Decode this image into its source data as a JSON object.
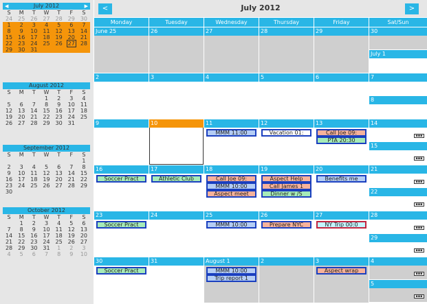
{
  "sidebar": {
    "months": [
      {
        "name": "July 2012",
        "prev": "◀",
        "next": "▶",
        "dow": [
          "S",
          "M",
          "T",
          "W",
          "T",
          "F",
          "S"
        ],
        "weeks": [
          [
            "24",
            "25",
            "26",
            "27",
            "28",
            "29",
            "30"
          ],
          [
            "1",
            "2",
            "3",
            "4",
            "5",
            "6",
            "7"
          ],
          [
            "8",
            "9",
            "10",
            "11",
            "12",
            "13",
            "14"
          ],
          [
            "15",
            "16",
            "17",
            "18",
            "19",
            "20",
            "21"
          ],
          [
            "22",
            "23",
            "24",
            "25",
            "26",
            "27",
            "28"
          ],
          [
            "29",
            "30",
            "31",
            "",
            "",
            "",
            ""
          ]
        ]
      },
      {
        "name": "August 2012",
        "dow": [
          "S",
          "M",
          "T",
          "W",
          "T",
          "F",
          "S"
        ],
        "weeks": [
          [
            "",
            "",
            "",
            "1",
            "2",
            "3",
            "4"
          ],
          [
            "5",
            "6",
            "7",
            "8",
            "9",
            "10",
            "11"
          ],
          [
            "12",
            "13",
            "14",
            "15",
            "16",
            "17",
            "18"
          ],
          [
            "19",
            "20",
            "21",
            "22",
            "23",
            "24",
            "25"
          ],
          [
            "26",
            "27",
            "28",
            "29",
            "30",
            "31",
            ""
          ]
        ]
      },
      {
        "name": "September 2012",
        "dow": [
          "S",
          "M",
          "T",
          "W",
          "T",
          "F",
          "S"
        ],
        "weeks": [
          [
            "",
            "",
            "",
            "",
            "",
            "",
            "1"
          ],
          [
            "2",
            "3",
            "4",
            "5",
            "6",
            "7",
            "8"
          ],
          [
            "9",
            "10",
            "11",
            "12",
            "13",
            "14",
            "15"
          ],
          [
            "16",
            "17",
            "18",
            "19",
            "20",
            "21",
            "22"
          ],
          [
            "23",
            "24",
            "25",
            "26",
            "27",
            "28",
            "29"
          ],
          [
            "30",
            "",
            "",
            "",
            "",
            "",
            ""
          ]
        ]
      },
      {
        "name": "October 2012",
        "dow": [
          "S",
          "M",
          "T",
          "W",
          "T",
          "F",
          "S"
        ],
        "weeks": [
          [
            "",
            "1",
            "2",
            "3",
            "4",
            "5",
            "6"
          ],
          [
            "7",
            "8",
            "9",
            "10",
            "11",
            "12",
            "13"
          ],
          [
            "14",
            "15",
            "16",
            "17",
            "18",
            "19",
            "20"
          ],
          [
            "21",
            "22",
            "23",
            "24",
            "25",
            "26",
            "27"
          ],
          [
            "28",
            "29",
            "30",
            "31",
            "1",
            "2",
            "3"
          ],
          [
            "4",
            "5",
            "6",
            "7",
            "8",
            "9",
            "10"
          ]
        ]
      }
    ]
  },
  "header": {
    "title": "July 2012",
    "prev": "<",
    "next": ">"
  },
  "days": [
    "Monday",
    "Tuesday",
    "Wednesday",
    "Thursday",
    "Friday",
    "Sat/Sun"
  ],
  "weeks": [
    {
      "days": [
        {
          "n": "June 25",
          "g": 1
        },
        {
          "n": "26",
          "g": 1
        },
        {
          "n": "27",
          "g": 1
        },
        {
          "n": "28",
          "g": 1
        },
        {
          "n": "29",
          "g": 1
        }
      ],
      "sat": "30",
      "sun": "July 1"
    },
    {
      "days": [
        {
          "n": "2"
        },
        {
          "n": "3"
        },
        {
          "n": "4"
        },
        {
          "n": "5"
        },
        {
          "n": "6"
        }
      ],
      "sat": "7",
      "sun": "8"
    },
    {
      "days": [
        {
          "n": "9"
        },
        {
          "n": "10",
          "t": 1
        },
        {
          "n": "11",
          "ev": [
            {
              "l": "MMM 11:00",
              "c": "blue"
            }
          ]
        },
        {
          "n": "12",
          "ev": [
            {
              "l": "Vacation 01:",
              "c": "white"
            }
          ]
        },
        {
          "n": "13",
          "ev": [
            {
              "l": "Call Joe 09:",
              "c": "pink"
            },
            {
              "l": "PTA 20:30",
              "c": "green"
            }
          ]
        }
      ],
      "sat": "14",
      "sun": "15",
      "mS": 1,
      "mU": 1
    },
    {
      "days": [
        {
          "n": "16",
          "ev": [
            {
              "l": "Soccer Pract",
              "c": "green"
            }
          ]
        },
        {
          "n": "17",
          "ev": [
            {
              "l": "Athletic Club",
              "c": "green"
            }
          ]
        },
        {
          "n": "18",
          "ev": [
            {
              "l": "Call Joe 09:",
              "c": "pink"
            },
            {
              "l": "MMM 10:00",
              "c": "blue"
            },
            {
              "l": "Aspect meet",
              "c": "pink"
            }
          ]
        },
        {
          "n": "19",
          "ev": [
            {
              "l": "Aspect Help",
              "c": "pink"
            },
            {
              "l": "Call James 1",
              "c": "pink"
            },
            {
              "l": "Dinner w /S",
              "c": "green"
            }
          ]
        },
        {
          "n": "20",
          "ev": [
            {
              "l": "Benefits me",
              "c": "blue"
            }
          ]
        }
      ],
      "sat": "21",
      "sun": "22",
      "mS": 1,
      "mU": 1
    },
    {
      "days": [
        {
          "n": "23",
          "ev": [
            {
              "l": "Soccer Pract",
              "c": "green"
            }
          ]
        },
        {
          "n": "24"
        },
        {
          "n": "25",
          "ev": [
            {
              "l": "MMM 10:00",
              "c": "blue"
            }
          ]
        },
        {
          "n": "26",
          "ev": [
            {
              "l": "Prepare NYC",
              "c": "pink"
            }
          ]
        },
        {
          "n": "27",
          "ev": [
            {
              "l": "NY Trip 00:0",
              "c": "cyan"
            }
          ]
        }
      ],
      "sat": "28",
      "sun": "29",
      "mS": 1,
      "mU": 1
    },
    {
      "days": [
        {
          "n": "30",
          "ev": [
            {
              "l": "Soccer Pract",
              "c": "green"
            }
          ]
        },
        {
          "n": "31"
        },
        {
          "n": "August 1",
          "g": 1,
          "ev": [
            {
              "l": "MMM 10:00",
              "c": "blue"
            },
            {
              "l": "Trip report 1",
              "c": "blue"
            }
          ]
        },
        {
          "n": "2",
          "g": 1
        },
        {
          "n": "3",
          "g": 1,
          "ev": [
            {
              "l": "Aspect wrap",
              "c": "pink"
            }
          ]
        }
      ],
      "sat": "4",
      "sun": "5",
      "gW": 1,
      "mS": 1,
      "mU": 1
    }
  ],
  "colors": {
    "accent": "#29b6e6",
    "today": "#f5950a",
    "selected_week": "#f5950a"
  },
  "icons": {
    "more": "ellipsis-box-icon"
  }
}
